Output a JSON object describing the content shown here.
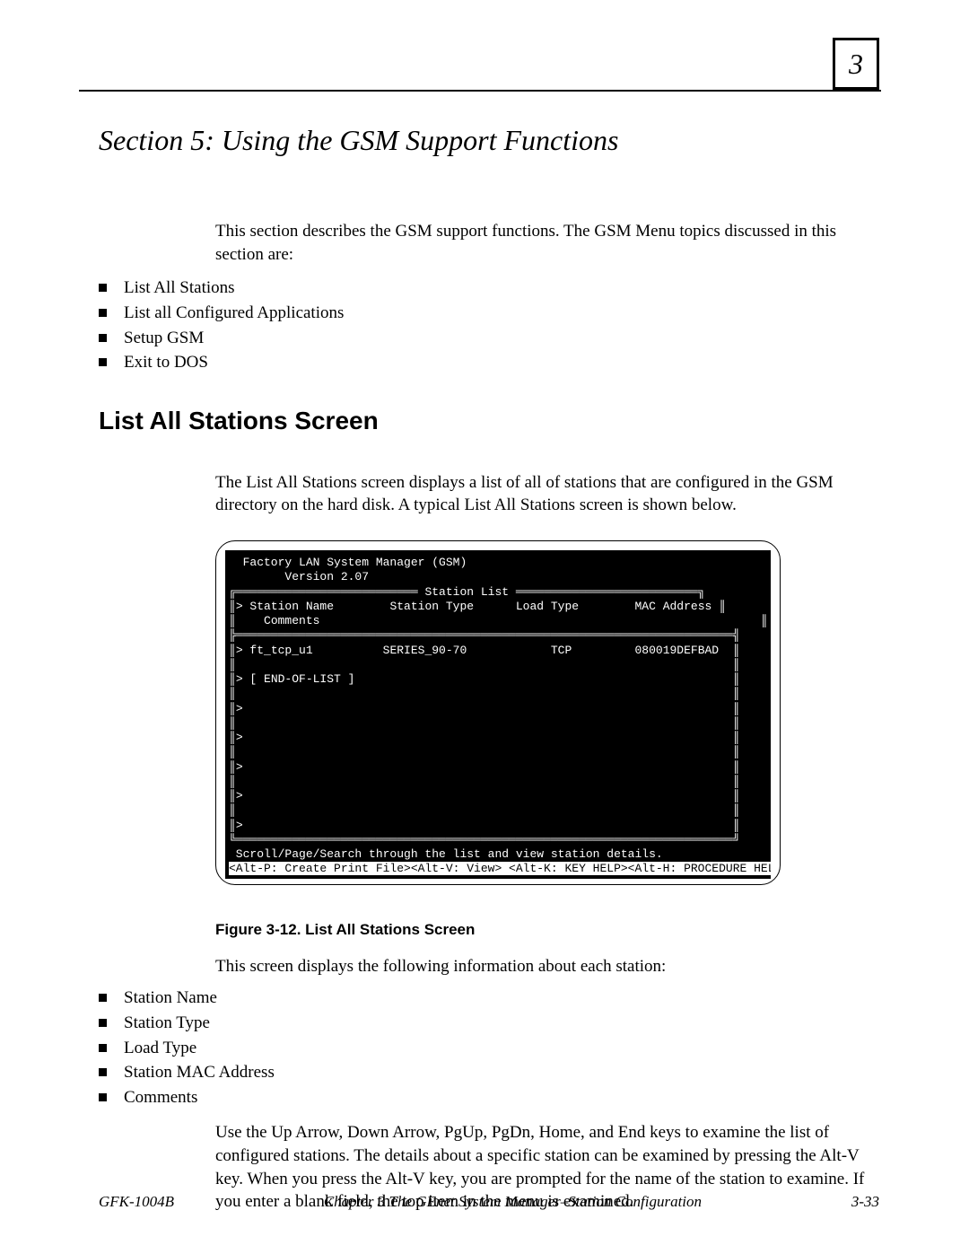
{
  "chapter_badge": "3",
  "section_title": "Section 5: Using the GSM Support Functions",
  "intro_para": "This section describes the GSM support functions.  The GSM Menu topics discussed in this section are:",
  "intro_bullets": [
    "List All Stations",
    "List all Configured Applications",
    "Setup GSM",
    "Exit to DOS"
  ],
  "h2_list_all": "List All Stations Screen",
  "list_all_para": "The List All Stations screen displays a list of all of  stations that are configured in the GSM directory on the hard disk.  A typical List All Stations screen  is shown below.",
  "terminal": {
    "title_line": "  Factory LAN System Manager (GSM)",
    "version_line": "        Version 2.07",
    "frame_label": " Station List ",
    "col_header": "> Station Name        Station Type      Load Type        MAC Address",
    "col_sub": "    Comments",
    "row1": "> ft_tcp_u1          SERIES_90-70            TCP         080019DEFBAD",
    "eol": "> [ END-OF-LIST ]",
    "blank1": ">",
    "blank2": ">",
    "blank3": ">",
    "blank4": ">",
    "blank5": ">",
    "hint": " Scroll/Page/Search through the list and view station details.",
    "keys": "<Alt-P: Create Print File><Alt-V: View> <Alt-K: KEY HELP><Alt-H: PROCEDURE HELP>"
  },
  "figure_caption": "Figure 3-12.  List All Stations Screen",
  "after_para": "This screen displays the following information about each station:",
  "info_bullets": [
    "Station Name",
    "Station Type",
    "Load Type",
    "Station MAC Address",
    "Comments"
  ],
  "nav_para": "Use the Up Arrow, Down Arrow, PgUp, PgDn, Home, and End keys to examine the list of configured stations.  The details about a specific station can be examined by pressing the Alt-V key.  When you press the Alt-V key, you are prompted for the name of the station to examine.  If you enter a blank field, the top item in the menu is examined.",
  "footer": {
    "docnum": "GFK-1004B",
    "center": "Chapter 3  The GEnet System Manager–Station   Configuration",
    "page": "3-33"
  }
}
